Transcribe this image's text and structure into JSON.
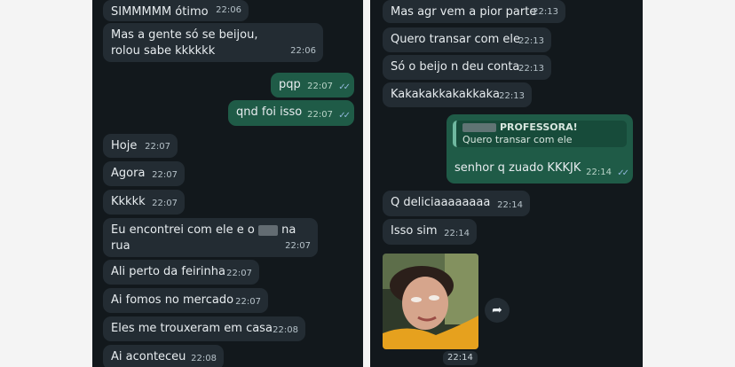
{
  "left": {
    "messages": [
      {
        "text": "SIMMMMM ótimo",
        "time": "22:06"
      },
      {
        "text": "Mas a gente só se beijou, rolou sabe kkkkkk",
        "time": "22:06"
      },
      {
        "text": "pqp",
        "time": "22:07"
      },
      {
        "text": "qnd foi isso",
        "time": "22:07"
      },
      {
        "text": "Hoje",
        "time": "22:07"
      },
      {
        "text": "Agora",
        "time": "22:07"
      },
      {
        "text": "Kkkkk",
        "time": "22:07"
      },
      {
        "text_before": "Eu encontrei com ele e o",
        "text_after": "na rua",
        "time": "22:07"
      },
      {
        "text": "Ali perto da feirinha",
        "time": "22:07"
      },
      {
        "text": "Ai fomos no mercado",
        "time": "22:07"
      },
      {
        "text": "Eles me trouxeram em casa",
        "time": "22:08"
      },
      {
        "text": "Ai aconteceu",
        "time": "22:08"
      }
    ]
  },
  "right": {
    "messages": [
      {
        "text": "Mas agr vem a pior parte",
        "time": "22:13"
      },
      {
        "text": "Quero transar com ele",
        "time": "22:13"
      },
      {
        "text": "Só o beijo n deu conta",
        "time": "22:13"
      },
      {
        "text": "Kakakakkakakkaka",
        "time": "22:13"
      },
      {
        "quote_name": "PROFESSORA!",
        "quote_text": "Quero transar com ele",
        "text": "senhor q zuado KKKJK",
        "time": "22:14"
      },
      {
        "text": "Q deliciaaaaaaaa",
        "time": "22:14"
      },
      {
        "text": "Isso sim",
        "time": "22:14"
      }
    ],
    "photo_time": "22:14"
  },
  "colors": {
    "background": "#12181c",
    "incoming": "#232c33",
    "outgoing": "#1f5b47",
    "read_ticks": "#8fb6d9"
  },
  "icons": {
    "read": "double-check-icon",
    "forward": "forward-arrow-icon"
  }
}
